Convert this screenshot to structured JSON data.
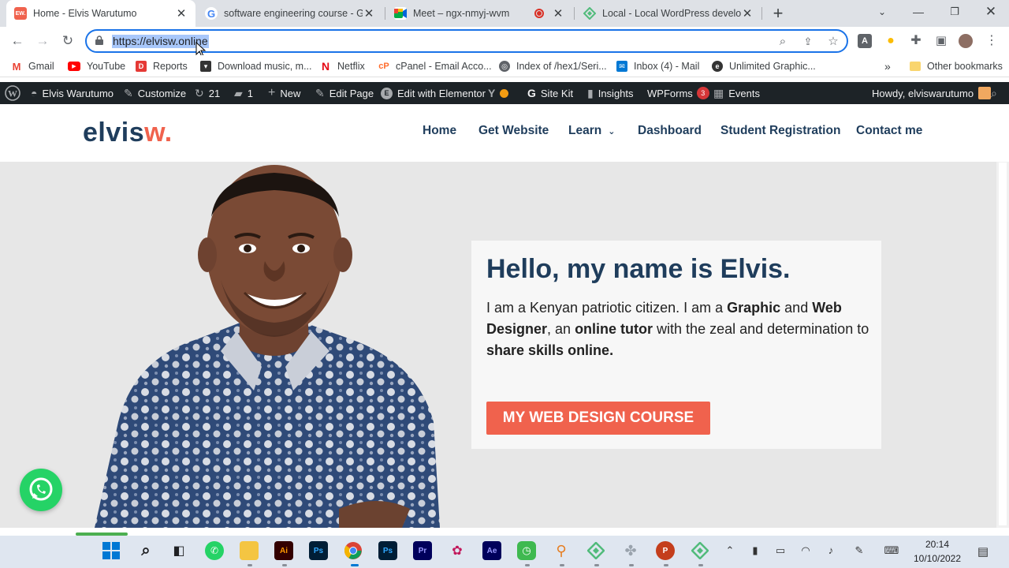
{
  "browser": {
    "tabs": [
      {
        "title": "Home - Elvis Warutumo",
        "favicon_text": "EW.",
        "favicon_color": "#f0624d",
        "active": true
      },
      {
        "title": "software engineering course - Go",
        "favicon_text": "G",
        "favicon_color": "#4285f4",
        "active": false
      },
      {
        "title": "Meet – ngx-nmyj-wvm",
        "favicon_text": "",
        "favicon_color": "#00897b",
        "active": false,
        "recording": true
      },
      {
        "title": "Local - Local WordPress develop",
        "favicon_text": "",
        "favicon_color": "#51bb7b",
        "active": false
      }
    ],
    "new_tab_label": "+",
    "url": "https://elvisw.online",
    "bookmarks": [
      {
        "label": "Gmail",
        "icon": "gmail-icon",
        "color": "#ea4335"
      },
      {
        "label": "YouTube",
        "icon": "youtube-icon",
        "color": "#ff0000"
      },
      {
        "label": "Reports",
        "icon": "reports-icon",
        "color": "#e53935"
      },
      {
        "label": "Download music, m...",
        "icon": "download-icon",
        "color": "#333333"
      },
      {
        "label": "Netflix",
        "icon": "netflix-icon",
        "color": "#e50914"
      },
      {
        "label": "cPanel - Email Acco...",
        "icon": "cpanel-icon",
        "color": "#ff6c2c"
      },
      {
        "label": "Index of /hex1/Seri...",
        "icon": "globe-icon",
        "color": "#5f6368"
      },
      {
        "label": "Inbox (4) - Mail",
        "icon": "mail-icon",
        "color": "#0078d4"
      },
      {
        "label": "Unlimited Graphic...",
        "icon": "graphic-icon",
        "color": "#333333"
      }
    ],
    "bookmarks_overflow": "»",
    "other_bookmarks": "Other bookmarks"
  },
  "wp_admin_bar": {
    "site_name": "Elvis Warutumo",
    "customize": "Customize",
    "updates_count": "21",
    "comments_count": "1",
    "new_label": "New",
    "edit_page": "Edit Page",
    "edit_elementor": "Edit with Elementor",
    "site_kit": "Site Kit",
    "insights": "Insights",
    "wpforms": "WPForms",
    "wpforms_badge": "3",
    "events": "Events",
    "howdy": "Howdy, elviswarutumo"
  },
  "site": {
    "logo_main": "elvis",
    "logo_accent": "w.",
    "nav": [
      "Home",
      "Get Website",
      "Learn",
      "Dashboard",
      "Student Registration",
      "Contact me"
    ],
    "hero": {
      "heading": "Hello, my name is Elvis.",
      "intro_parts": [
        {
          "text": "I am a Kenyan patriotic citizen. I am a ",
          "bold": false
        },
        {
          "text": "Graphic",
          "bold": true
        },
        {
          "text": " and ",
          "bold": false
        },
        {
          "text": "Web Designer",
          "bold": true
        },
        {
          "text": ", an ",
          "bold": false
        },
        {
          "text": "online tutor",
          "bold": true
        },
        {
          "text": " with the zeal and determination to ",
          "bold": false
        },
        {
          "text": "share skills online.",
          "bold": true
        }
      ],
      "cta": "MY WEB DESIGN COURSE"
    },
    "colors": {
      "primary": "#1f3d5c",
      "accent": "#f0624d",
      "hero_bg": "#e7e7e7"
    }
  },
  "taskbar": {
    "apps": [
      "windows-start",
      "search",
      "task-view",
      "whatsapp",
      "file-explorer",
      "illustrator",
      "photoshop",
      "chrome",
      "photoshop-2",
      "premiere",
      "paint",
      "after-effects",
      "clock-app",
      "magnifier",
      "local-app",
      "photos-app",
      "powerpoint",
      "local-app-2"
    ],
    "time": "20:14",
    "date": "10/10/2022"
  }
}
